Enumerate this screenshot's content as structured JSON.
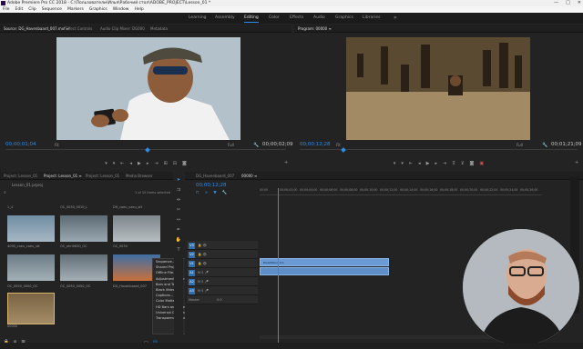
{
  "window": {
    "title": "Adobe Premiere Pro CC 2018 - C:\\Пользователи\\Илья\\Рабочий стол\\ADOBE_PROJECT\\Lesson_01 *",
    "controls": [
      "—",
      "□",
      "✕"
    ]
  },
  "menu": [
    "File",
    "Edit",
    "Clip",
    "Sequence",
    "Markers",
    "Graphics",
    "Window",
    "Help"
  ],
  "workspaces": [
    {
      "label": "Learning",
      "active": false
    },
    {
      "label": "Assembly",
      "active": false
    },
    {
      "label": "Editing",
      "active": true
    },
    {
      "label": "Color",
      "active": false
    },
    {
      "label": "Effects",
      "active": false
    },
    {
      "label": "Audio",
      "active": false
    },
    {
      "label": "Graphics",
      "active": false
    },
    {
      "label": "Libraries",
      "active": false
    }
  ],
  "workspaces_more": "»",
  "source": {
    "tabs": [
      "Source: DG_Havenbaard_007.mxf ≡",
      "Effect Controls",
      "Audio Clip Mixer: DG000",
      "Metadata"
    ],
    "timecode": "00;00;01;04",
    "fit": "Fit",
    "quality": "Full",
    "duration": "00;00;02;09"
  },
  "program": {
    "tabs": [
      "Program: 00000 ≡"
    ],
    "timecode": "00;00;12;28",
    "fit": "Fit",
    "quality": "Full",
    "duration": "00;01;21;09"
  },
  "project": {
    "tabs": [
      "Project: Lesson_01",
      "Project: Lesson_01 ≡",
      "Project: Lesson_01",
      "Media Browser"
    ],
    "folder": "Lesson_01.prproj",
    "items_selected": "1 of 15 items selected",
    "thumbs": [
      {
        "label": "1_4"
      },
      {
        "label": "OC_0030_0010_L"
      },
      {
        "label": "DH_caeu_caeu_stt"
      },
      {
        "label": "4090_caeu_caeu_stt"
      },
      {
        "label": "OC_ehri0630_OC"
      },
      {
        "label": "OC_0030"
      },
      {
        "label": "OC_0050_0050_OC"
      },
      {
        "label": "OC_0050_0050_OC"
      },
      {
        "label": "DG_Havenbaard_007"
      },
      {
        "label": "00000"
      }
    ]
  },
  "context_menu": {
    "items": [
      "Sequence...",
      "Shared Project...",
      "Offline File...",
      "Adjustment Layer...",
      "Bars and Tone...",
      "Black Video...",
      "Captions...",
      "Color Matte...",
      "HD Bars and Tone...",
      "Universal Counting Leader...",
      "Transparent Video..."
    ]
  },
  "timeline": {
    "tabs": [
      "DG_Havenbaard_007",
      "00000 ≡"
    ],
    "timecode": "00;00;12;28",
    "ruler": [
      "00;00",
      "00;00;02;00",
      "00;00;04;00",
      "00;00;06;00",
      "00;00;08;00",
      "00;00;10;00",
      "00;00;12;00",
      "00;00;14;00",
      "00;00;16;00",
      "00;00;18;00",
      "00;00;20;00",
      "00;00;22;00",
      "00;00;24;00",
      "00;00;26;00",
      "00;00;28;00",
      "00;00;30;00"
    ],
    "tracks": [
      {
        "name": "V3"
      },
      {
        "name": "V2"
      },
      {
        "name": "V1"
      },
      {
        "name": "A1"
      },
      {
        "name": "A2"
      },
      {
        "name": "A3"
      },
      {
        "name": "Master"
      }
    ],
    "clips": [
      {
        "label": "DG0/0Pand 0.C",
        "track": "V1"
      },
      {
        "label": "",
        "track": "A1"
      }
    ],
    "master_level": "0.0"
  },
  "colors": {
    "accent": "#2d8ceb",
    "clip": "#6a9bd5",
    "bg": "#232323"
  }
}
